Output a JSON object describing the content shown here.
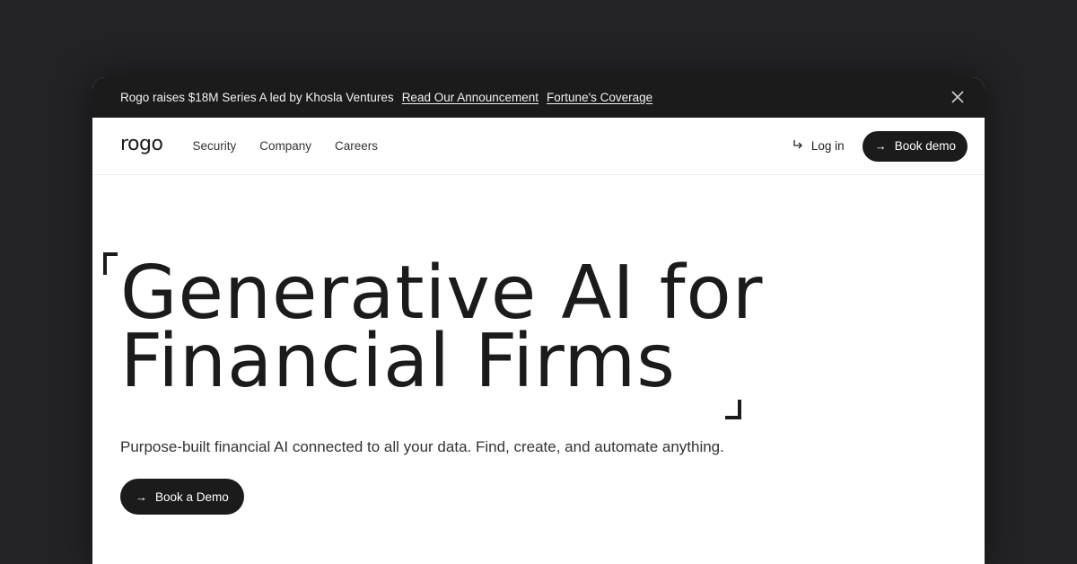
{
  "banner": {
    "message": "Rogo raises $18M Series A led by Khosla Ventures",
    "link_announcement": "Read Our Announcement",
    "link_coverage": "Fortune's Coverage",
    "close_icon": "close-icon"
  },
  "nav": {
    "logo": "rogo",
    "links": [
      "Security",
      "Company",
      "Careers"
    ],
    "login_label": "Log in",
    "login_icon": "corner-down-right-icon",
    "book_demo_label": "Book demo",
    "book_demo_icon": "arrow-right-icon"
  },
  "hero": {
    "headline_line1": "Generative AI for",
    "headline_line2": "Financial Firms",
    "subheadline": "Purpose-built financial AI connected to all your data. Find, create, and automate anything.",
    "cta_label": "Book a Demo",
    "cta_icon": "arrow-right-icon"
  },
  "colors": {
    "background": "#232326",
    "banner_bg": "#1b1b1b",
    "primary_dark": "#1b1b1b",
    "page_bg": "#ffffff"
  }
}
